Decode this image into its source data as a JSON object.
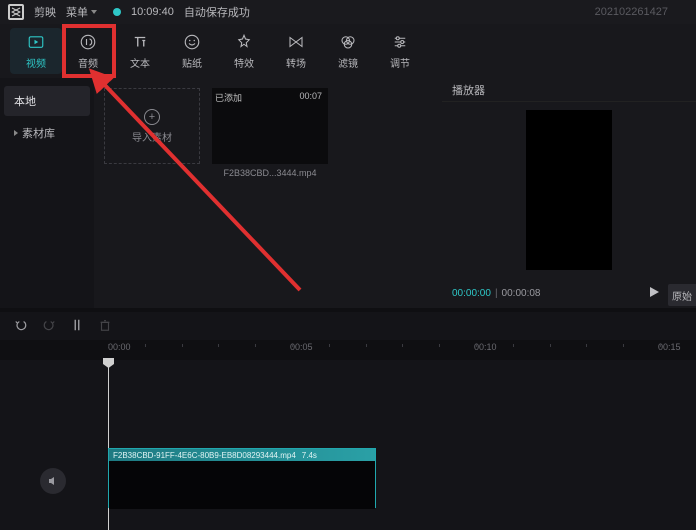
{
  "top": {
    "app_name": "剪映",
    "menu_label": "菜单",
    "save_time": "10:09:40",
    "save_status": "自动保存成功",
    "timestamp": "202102261427"
  },
  "tabs": {
    "video": "视频",
    "audio": "音频",
    "text": "文本",
    "sticker": "贴纸",
    "effect": "特效",
    "transition": "转场",
    "filter": "滤镜",
    "adjust": "调节"
  },
  "sidebar": {
    "local": "本地",
    "library": "素材库"
  },
  "import_label": "导入素材",
  "clip": {
    "badge": "已添加",
    "duration": "00:07",
    "name": "F2B38CBD...3444.mp4"
  },
  "preview": {
    "title": "播放器",
    "cur": "00:00:00",
    "tot": "00:00:08",
    "orig": "原始"
  },
  "ruler": {
    "t0": "00:00",
    "t1": "00:05",
    "t2": "00:10",
    "t3": "00:15"
  },
  "timeline_clip": {
    "name": "F2B38CBD-91FF-4E6C-80B9-EB8D08293444.mp4",
    "dur": "7.4s"
  }
}
